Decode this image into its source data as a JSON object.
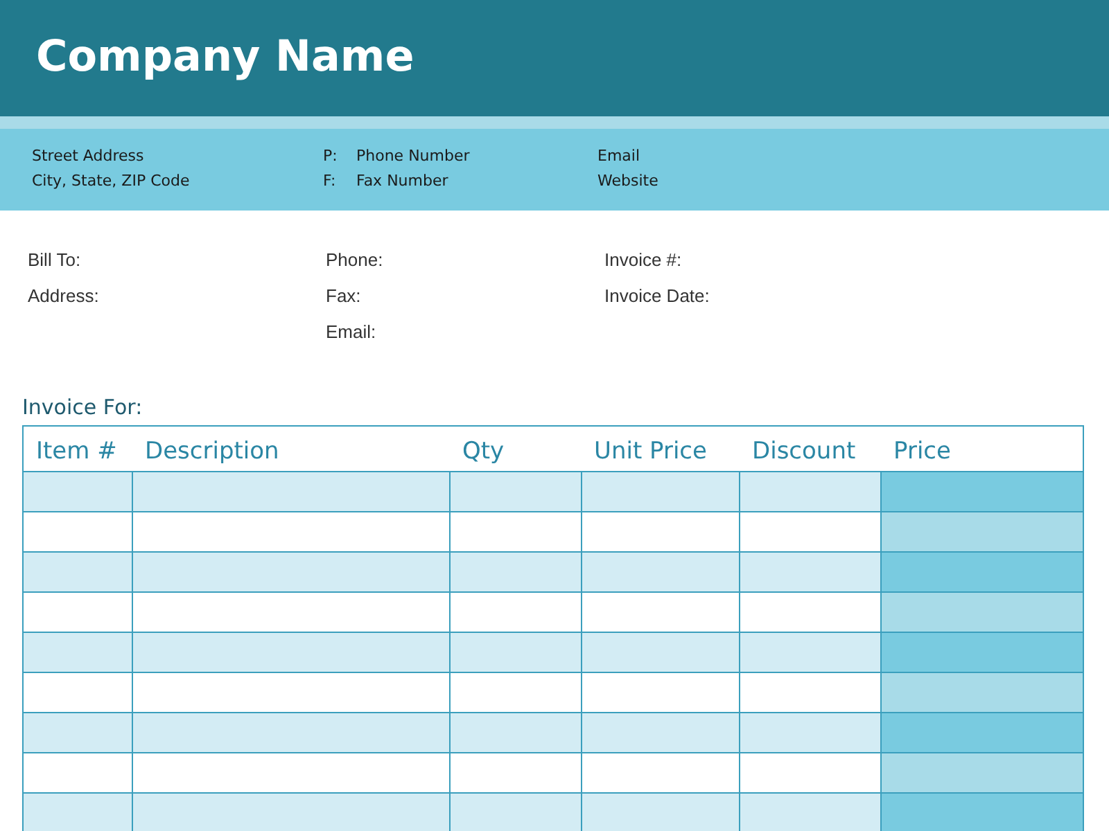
{
  "header": {
    "company": "Company Name"
  },
  "contact": {
    "address": [
      "Street Address",
      "City, State, ZIP Code"
    ],
    "phones": [
      {
        "prefix": "P:",
        "value": "Phone Number"
      },
      {
        "prefix": "F:",
        "value": "Fax Number"
      }
    ],
    "web": [
      "Email",
      "Website"
    ]
  },
  "bill": {
    "columns": [
      [
        "Bill To:",
        "Address:"
      ],
      [
        "Phone:",
        "Fax:",
        "Email:"
      ],
      [
        "Invoice #:",
        "Invoice Date:"
      ]
    ]
  },
  "invoice_for": "Invoice For:",
  "table": {
    "columns": [
      "Item #",
      "Description",
      "Qty",
      "Unit Price",
      "Discount",
      "Price"
    ],
    "rows": [
      {
        "shaded": true
      },
      {
        "shaded": false
      },
      {
        "shaded": true
      },
      {
        "shaded": false
      },
      {
        "shaded": true
      },
      {
        "shaded": false
      },
      {
        "shaded": true
      },
      {
        "shaded": false
      },
      {
        "shaded": true
      }
    ]
  }
}
